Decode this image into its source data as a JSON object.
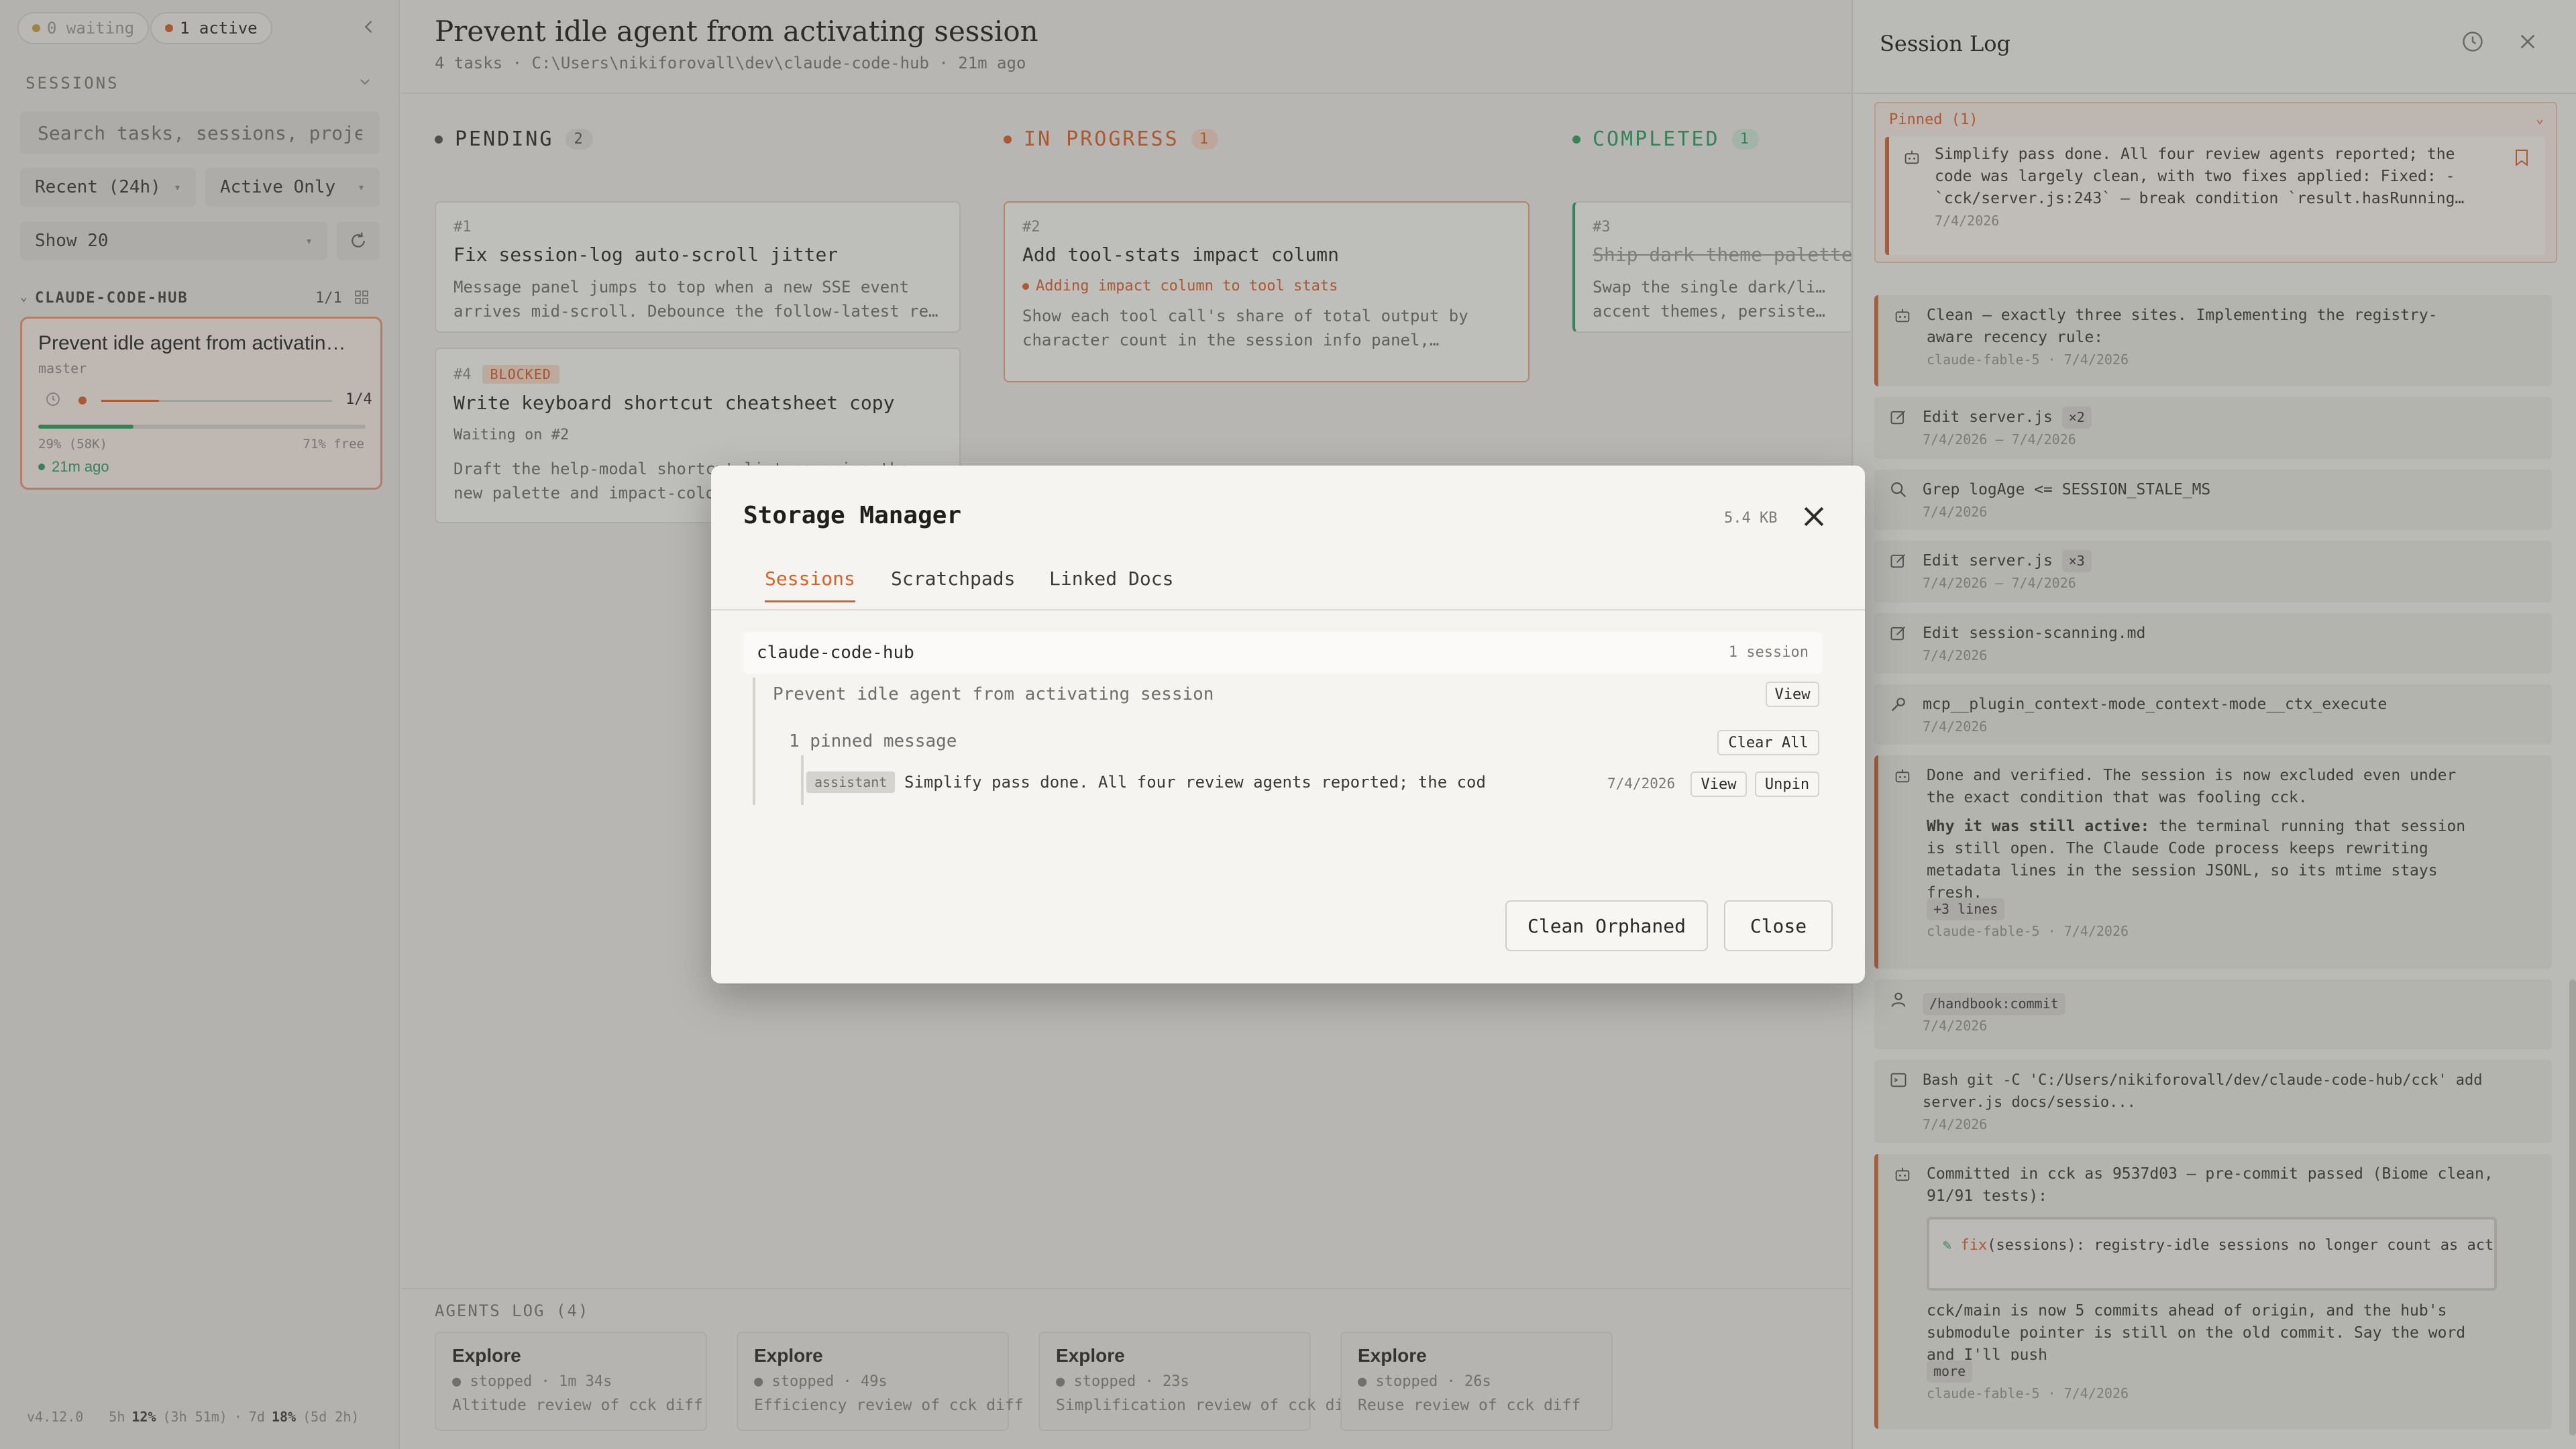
{
  "sidebar": {
    "waiting_pill": "0 waiting",
    "active_pill": "1 active",
    "sessions_heading": "SESSIONS",
    "search_placeholder": "Search tasks, sessions, proje",
    "filter_recent": "Recent (24h)",
    "filter_active": "Active Only",
    "show_count": "Show 20",
    "project_name": "CLAUDE-CODE-HUB",
    "project_count": "1/1",
    "session_card": {
      "title": "Prevent idle agent from activatin…",
      "branch": "master",
      "progress": "1/4",
      "progress_value": 0.25,
      "context_used": "29% (58K)",
      "context_free": "71% free",
      "context_fraction": 0.29,
      "time": "21m ago"
    },
    "version": "v4.12.0",
    "usage": {
      "five_h_label": "5h",
      "five_h_pct": "12%",
      "five_h_reset": "(3h 51m)",
      "sep": "·",
      "seven_d_label": "7d",
      "seven_d_pct": "18%",
      "seven_d_reset": "(5d 2h)"
    }
  },
  "main": {
    "title": "Prevent idle agent from activating session",
    "subtitle": "4 tasks · C:\\Users\\nikiforovall\\dev\\claude-code-hub · 21m ago",
    "columns": [
      {
        "label": "PENDING",
        "count": "2"
      },
      {
        "label": "IN PROGRESS",
        "count": "1"
      },
      {
        "label": "COMPLETED",
        "count": "1"
      }
    ],
    "tasks": [
      {
        "num": "#1",
        "title": "Fix session-log auto-scroll jitter",
        "desc1": "Message panel jumps to top when a new SSE event",
        "desc2": "arrives mid-scroll. Debounce the follow-latest re…"
      },
      {
        "num": "#4",
        "badge": "BLOCKED",
        "title": "Write keyboard shortcut cheatsheet copy",
        "waiting": "Waiting on #2",
        "desc1": "Draft the help-modal shortcut list covering the",
        "desc2": "new palette and impact-color bindings."
      },
      {
        "num": "#2",
        "title": "Add tool-stats impact column",
        "status": "Adding impact column to tool stats",
        "desc1": "Show each tool call's share of total output by",
        "desc2": "character count in the session info panel,…"
      },
      {
        "num": "#3",
        "title": "Ship dark theme palette p…",
        "desc1": "Swap the single dark/light toggle for",
        "desc2": "accent themes, persisted pe…"
      }
    ],
    "agents_log_title": "AGENTS LOG (4)",
    "agents": [
      {
        "name": "Explore",
        "meta": "stopped · 1m 34s",
        "desc": "Altitude review of cck diff"
      },
      {
        "name": "Explore",
        "meta": "stopped · 49s",
        "desc": "Efficiency review of cck diff"
      },
      {
        "name": "Explore",
        "meta": "stopped · 23s",
        "desc": "Simplification review of cck diff"
      },
      {
        "name": "Explore",
        "meta": "stopped · 26s",
        "desc": "Reuse review of cck diff"
      }
    ]
  },
  "session_log": {
    "title": "Session Log",
    "pinned_header": "Pinned (1)",
    "pinned": {
      "text1": "Simplify pass done. All four review agents reported; the",
      "text2": "code was largely clean, with two fixes applied: Fixed: -",
      "text3": "`cck/server.js:243` — break condition `result.hasRunning…",
      "date": "7/4/2026"
    },
    "entries": [
      {
        "type": "assistant",
        "lines": [
          "Clean — exactly three sites. Implementing the registry-",
          "aware recency rule:"
        ],
        "meta": "claude-fable-5 · 7/4/2026"
      },
      {
        "type": "edit",
        "text": "Edit server.js",
        "chip": "×2",
        "meta": "7/4/2026 – 7/4/2026"
      },
      {
        "type": "grep",
        "text": "Grep logAge <= SESSION_STALE_MS",
        "meta": "7/4/2026"
      },
      {
        "type": "edit",
        "text": "Edit server.js",
        "chip": "×3",
        "meta": "7/4/2026 – 7/4/2026"
      },
      {
        "type": "edit",
        "text": "Edit session-scanning.md",
        "meta": "7/4/2026"
      },
      {
        "type": "tool",
        "text": "mcp__plugin_context-mode_context-mode__ctx_execute",
        "meta": "7/4/2026"
      },
      {
        "type": "assistant",
        "lines": [
          "Done and verified. The session is now excluded even under",
          "the exact condition that was fooling cck."
        ],
        "bold": "Why it was still active:",
        "rest": " the terminal running that session",
        "lines2": [
          "is still open. The Claude Code process keeps rewriting",
          "metadata lines in the session JSONL, so its mtime stays",
          "fresh."
        ],
        "chip": "+3 lines",
        "meta": "claude-fable-5 · 7/4/2026"
      },
      {
        "type": "user",
        "chip": "/handbook:commit",
        "meta": "7/4/2026"
      },
      {
        "type": "bash",
        "lines": [
          "Bash git -C 'C:/Users/nikiforovall/dev/claude-code-hub/cck' add",
          "server.js docs/sessio..."
        ],
        "meta": "7/4/2026"
      },
      {
        "type": "assistant",
        "lines": [
          "Committed in cck as 9537d03 — pre-commit passed (Biome clean,",
          "91/91 tests):"
        ],
        "code_prefix": "fix",
        "code_rest": "(sessions): registry-idle sessions no longer count as active",
        "lines2": [
          "cck/main is now 5 commits ahead of origin, and the hub's",
          "submodule pointer is still on the old commit. Say the word",
          "and I'll push"
        ],
        "chip": "more",
        "meta": "claude-fable-5 · 7/4/2026"
      }
    ]
  },
  "modal": {
    "title": "Storage Manager",
    "size": "5.4 KB",
    "tabs": [
      "Sessions",
      "Scratchpads",
      "Linked Docs"
    ],
    "project": "claude-code-hub",
    "project_count": "1 session",
    "session_title": "Prevent idle agent from activating session",
    "view_label": "View",
    "pinned_count": "1 pinned message",
    "clear_all": "Clear All",
    "message_role": "assistant",
    "message_text": "Simplify pass done. All four review agents reported; the cod",
    "message_date": "7/4/2026",
    "unpin": "Unpin",
    "clean_orphaned": "Clean Orphaned",
    "close": "Close"
  },
  "colors": {
    "accent": "#d9622b",
    "pending": "#555555",
    "in_progress": "#d9622b",
    "completed": "#2e9e63",
    "blocked_bg": "#f6d9c8"
  }
}
